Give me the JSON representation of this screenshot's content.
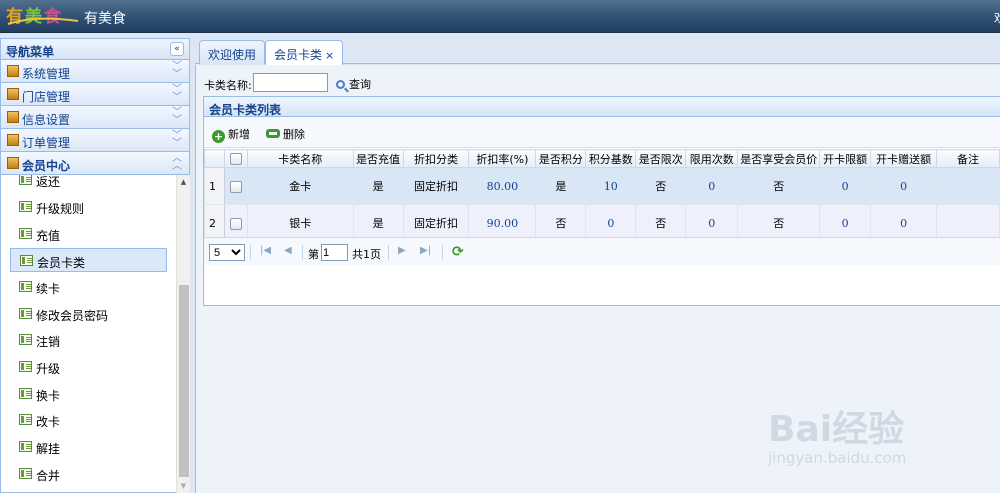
{
  "header": {
    "logo_text": "有美食",
    "app_title": "有美食",
    "right_text": "欢"
  },
  "nav": {
    "title": "导航菜单",
    "groups": [
      {
        "label": "系统管理"
      },
      {
        "label": "门店管理"
      },
      {
        "label": "信息设置"
      },
      {
        "label": "订单管理"
      },
      {
        "label": "会员中心"
      }
    ],
    "items": [
      {
        "label": "返还"
      },
      {
        "label": "升级规则"
      },
      {
        "label": "充值"
      },
      {
        "label": "会员卡类",
        "active": true
      },
      {
        "label": "续卡"
      },
      {
        "label": "修改会员密码"
      },
      {
        "label": "注销"
      },
      {
        "label": "升级"
      },
      {
        "label": "换卡"
      },
      {
        "label": "改卡"
      },
      {
        "label": "解挂"
      },
      {
        "label": "合并"
      }
    ]
  },
  "tabs": [
    {
      "label": "欢迎使用"
    },
    {
      "label": "会员卡类",
      "close": "×"
    }
  ],
  "search": {
    "label": "卡类名称:",
    "value": "",
    "button": "查询"
  },
  "grid": {
    "title": "会员卡类列表",
    "add_label": "新增",
    "delete_label": "删除",
    "columns": [
      "卡类名称",
      "是否充值",
      "折扣分类",
      "折扣率(%)",
      "是否积分",
      "积分基数",
      "是否限次",
      "限用次数",
      "是否享受会员价",
      "开卡限额",
      "开卡赠送额",
      "备注"
    ],
    "rows": [
      {
        "no": "1",
        "cells": [
          "金卡",
          "是",
          "固定折扣",
          "80.00",
          "是",
          "10",
          "否",
          "0",
          "否",
          "0",
          "0",
          ""
        ]
      },
      {
        "no": "2",
        "cells": [
          "银卡",
          "是",
          "固定折扣",
          "90.00",
          "否",
          "0",
          "否",
          "0",
          "否",
          "0",
          "0",
          ""
        ]
      }
    ]
  },
  "pager": {
    "page_size": "5",
    "page_prefix": "第",
    "page_value": "1",
    "total_pages": "共1页"
  },
  "watermark": {
    "main": "Bai经验",
    "sub": "jingyan.baidu.com"
  }
}
